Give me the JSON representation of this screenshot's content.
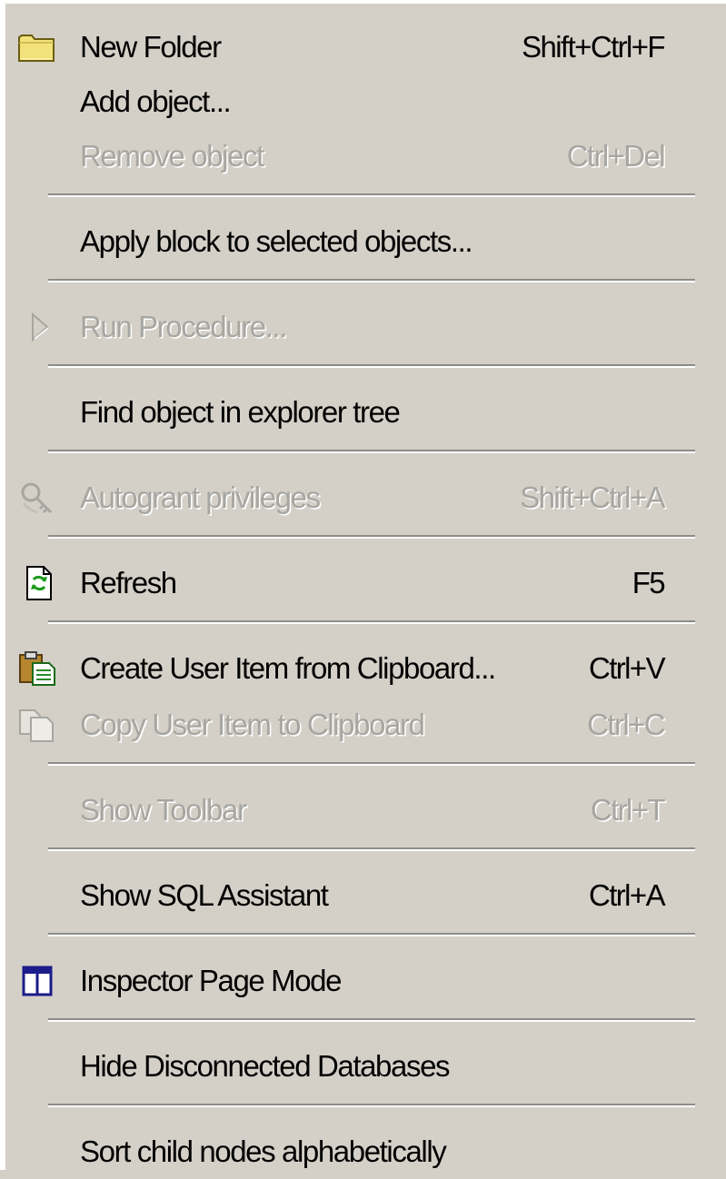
{
  "menu": {
    "items": [
      {
        "label": "New Folder",
        "shortcut": "Shift+Ctrl+F",
        "enabled": true,
        "icon": "folder-icon"
      },
      {
        "label": "Add object...",
        "shortcut": "",
        "enabled": true,
        "icon": ""
      },
      {
        "label": "Remove object",
        "shortcut": "Ctrl+Del",
        "enabled": false,
        "icon": ""
      },
      {
        "label": "Apply block to selected objects...",
        "shortcut": "",
        "enabled": true,
        "icon": ""
      },
      {
        "label": "Run Procedure...",
        "shortcut": "",
        "enabled": false,
        "icon": "play-triangle-icon"
      },
      {
        "label": "Find object in explorer tree",
        "shortcut": "",
        "enabled": true,
        "icon": ""
      },
      {
        "label": "Autogrant privileges",
        "shortcut": "Shift+Ctrl+A",
        "enabled": false,
        "icon": "key-privileges-icon"
      },
      {
        "label": "Refresh",
        "shortcut": "F5",
        "enabled": true,
        "icon": "refresh-document-icon"
      },
      {
        "label": "Create User Item from Clipboard...",
        "shortcut": "Ctrl+V",
        "enabled": true,
        "icon": "clipboard-paste-icon"
      },
      {
        "label": "Copy User Item to Clipboard",
        "shortcut": "Ctrl+C",
        "enabled": false,
        "icon": "copy-documents-icon"
      },
      {
        "label": "Show Toolbar",
        "shortcut": "Ctrl+T",
        "enabled": false,
        "icon": ""
      },
      {
        "label": "Show SQL Assistant",
        "shortcut": "Ctrl+A",
        "enabled": true,
        "icon": ""
      },
      {
        "label": "Inspector Page Mode",
        "shortcut": "",
        "enabled": true,
        "icon": "inspector-pages-icon"
      },
      {
        "label": "Hide Disconnected Databases",
        "shortcut": "",
        "enabled": true,
        "icon": ""
      },
      {
        "label": "Sort child nodes alphabetically",
        "shortcut": "",
        "enabled": true,
        "icon": ""
      }
    ]
  },
  "colors": {
    "menu_background": "#d4d0c8",
    "disabled_text": "#a8a6a0",
    "separator_shadow": "#8f8c86",
    "separator_highlight": "#ffffff"
  }
}
